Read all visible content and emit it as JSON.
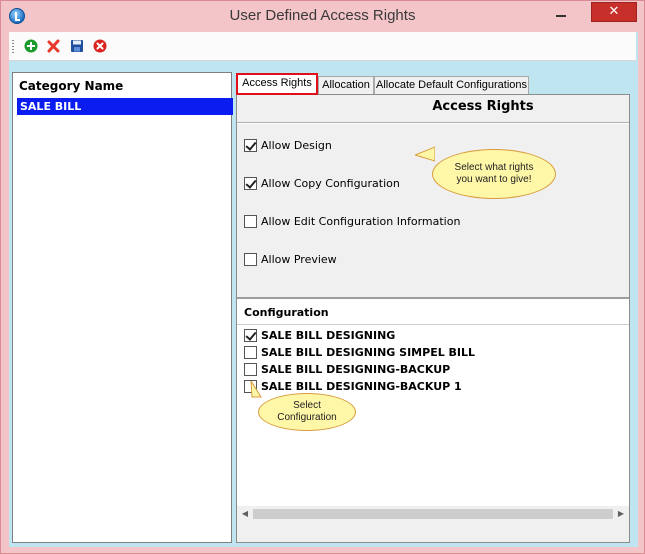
{
  "window": {
    "title": "User Defined Access Rights",
    "close_label": "✕"
  },
  "toolbar": {
    "buttons": [
      {
        "name": "add",
        "icon": "add-icon",
        "color": "#1a9a2a"
      },
      {
        "name": "delete",
        "icon": "delete-icon",
        "color": "#e8392a"
      },
      {
        "name": "save",
        "icon": "save-icon",
        "color": "#1f4f9e"
      },
      {
        "name": "cancel",
        "icon": "cancel-icon",
        "color": "#d8261f"
      }
    ]
  },
  "category": {
    "header": "Category Name",
    "items": [
      {
        "label": "SALE BILL",
        "selected": true
      }
    ]
  },
  "tabs": [
    {
      "label": "Access Rights",
      "active": true
    },
    {
      "label": "Allocation",
      "active": false
    },
    {
      "label": "Allocate Default Configurations",
      "active": false
    }
  ],
  "access_rights": {
    "title": "Access Rights",
    "options": [
      {
        "label": "Allow Design",
        "checked": true
      },
      {
        "label": "Allow Copy Configuration",
        "checked": true
      },
      {
        "label": "Allow Edit Configuration Information",
        "checked": false
      },
      {
        "label": "Allow Preview",
        "checked": false
      }
    ],
    "callout": "Select what rights you want to give!"
  },
  "configuration": {
    "header": "Configuration",
    "items": [
      {
        "label": "SALE BILL DESIGNING",
        "checked": true
      },
      {
        "label": "SALE BILL DESIGNING SIMPEL BILL",
        "checked": false
      },
      {
        "label": "SALE BILL DESIGNING-BACKUP",
        "checked": false
      },
      {
        "label": "SALE BILL DESIGNING-BACKUP 1",
        "checked": false
      }
    ],
    "callout": "Select Configuration"
  },
  "colors": {
    "selection": "#0a1cf0",
    "active_tab_border": "#e0101a",
    "callout_fill": "#fff7a8",
    "frame": "#f3c4c8",
    "client": "#bfe6f0"
  }
}
